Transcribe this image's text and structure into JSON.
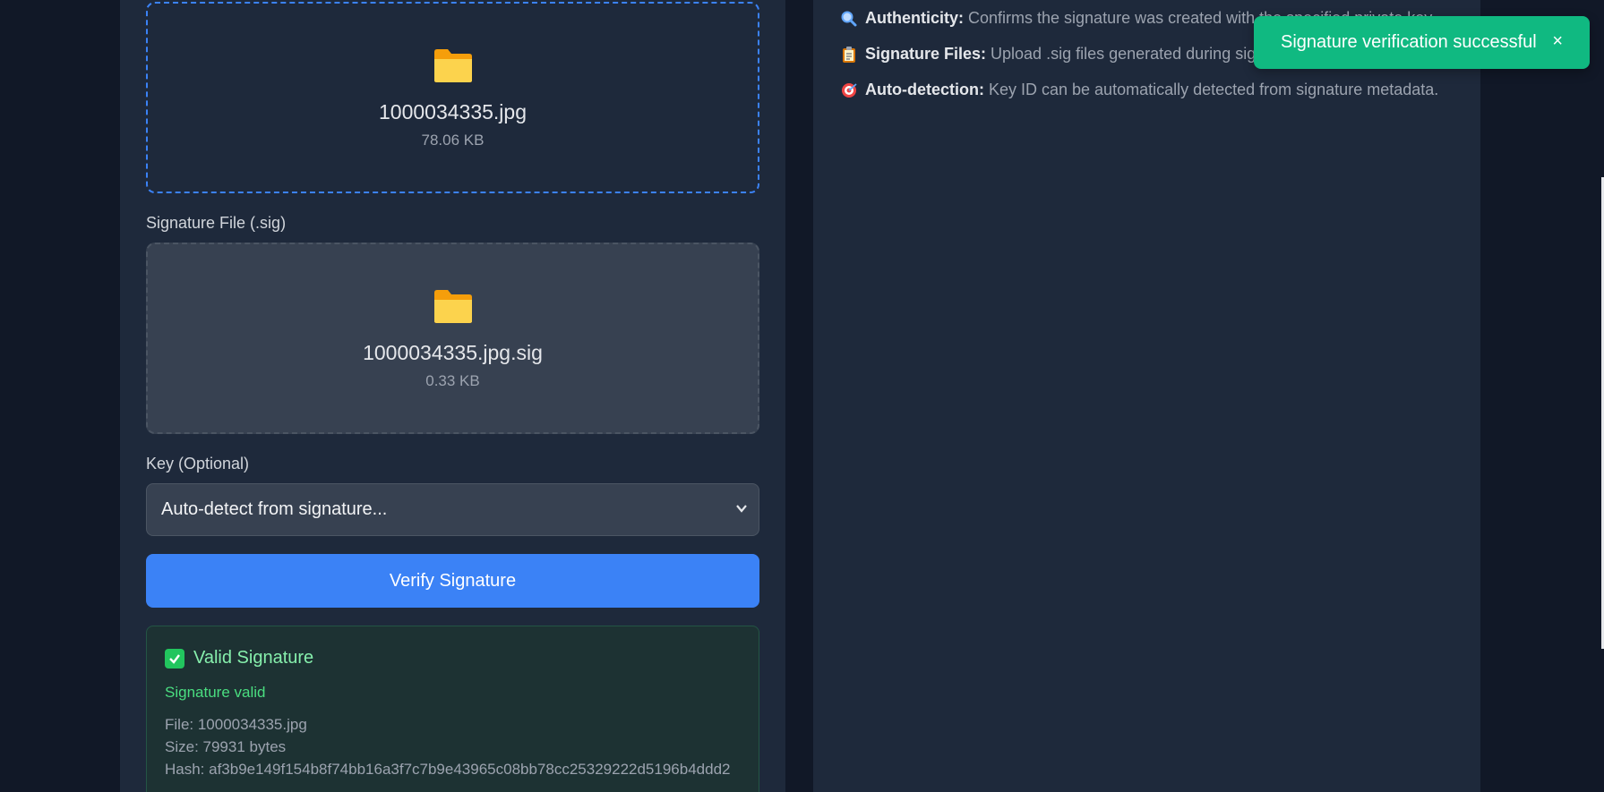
{
  "upload": {
    "file_name": "1000034335.jpg",
    "file_size": "78.06 KB"
  },
  "signature": {
    "label": "Signature File (.sig)",
    "file_name": "1000034335.jpg.sig",
    "file_size": "0.33 KB"
  },
  "key": {
    "label": "Key (Optional)",
    "selected": "Auto-detect from signature..."
  },
  "verify_button": "Verify Signature",
  "result": {
    "title": "Valid Signature",
    "status": "Signature valid",
    "file": "File: 1000034335.jpg",
    "size": "Size: 79931 bytes",
    "hash": "Hash: af3b9e149f154b8f74bb16a3f7c7b9e43965c08bb78cc25329222d5196b4ddd2"
  },
  "info": [
    {
      "icon": "magnifier-icon",
      "title": "Authenticity:",
      "text": "Confirms the signature was created with the specified private key."
    },
    {
      "icon": "clipboard-icon",
      "title": "Signature Files:",
      "text": "Upload .sig files generated during signing."
    },
    {
      "icon": "target-icon",
      "title": "Auto-detection:",
      "text": "Key ID can be automatically detected from signature metadata."
    }
  ],
  "toast": {
    "message": "Signature verification successful",
    "close": "×"
  },
  "colors": {
    "accent": "#3b82f6",
    "success": "#10b981",
    "panel": "#1e293b",
    "background": "#111827"
  }
}
